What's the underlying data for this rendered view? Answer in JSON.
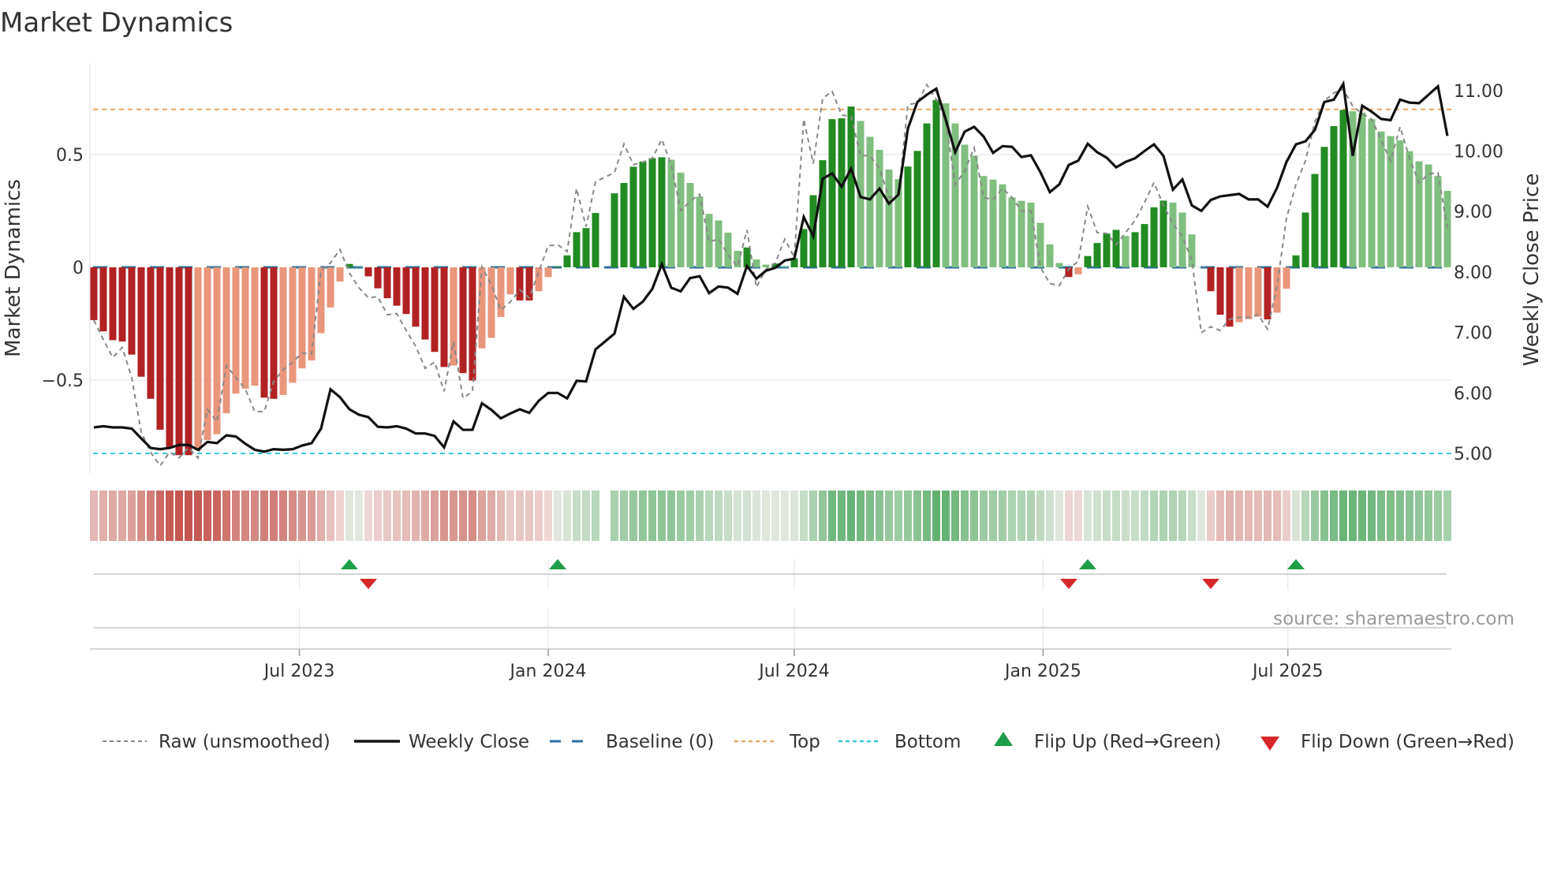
{
  "title": "Market Dynamics",
  "source": "source: sharemaestro.com",
  "colors": {
    "strong_red": "#b22222",
    "weak_red": "#e9967a",
    "strong_green": "#228b22",
    "weak_green": "#7fbf7f",
    "raw": "#888888",
    "close": "#111111",
    "baseline": "#2b6f9e",
    "top": "#e8a862",
    "bottom": "#3cc8d8",
    "flip_up": "#1e9e4a",
    "flip_down": "#d62728",
    "heat_red": "#c4544c",
    "heat_green": "#4fab62"
  },
  "legend": [
    {
      "key": "raw",
      "label": "Raw (unsmoothed)"
    },
    {
      "key": "close",
      "label": "Weekly Close"
    },
    {
      "key": "baseline",
      "label": "Baseline (0)"
    },
    {
      "key": "top",
      "label": "Top"
    },
    {
      "key": "bottom",
      "label": "Bottom"
    },
    {
      "key": "flip_up",
      "label": "Flip Up (Red→Green)"
    },
    {
      "key": "flip_down",
      "label": "Flip Down (Green→Red)"
    }
  ],
  "chart_data": {
    "type": "bar",
    "title": "Market Dynamics",
    "ylabel": "Market Dynamics",
    "y2label": "Weekly Close Price",
    "x_start": "2023-01-30",
    "x_step_days": 7,
    "x_ticks": [
      {
        "date": "2023-07-01",
        "label": "Jul 2023"
      },
      {
        "date": "2024-01-01",
        "label": "Jan 2024"
      },
      {
        "date": "2024-07-01",
        "label": "Jul 2024"
      },
      {
        "date": "2025-01-01",
        "label": "Jan 2025"
      },
      {
        "date": "2025-07-01",
        "label": "Jul 2025"
      }
    ],
    "y_ticks": [
      {
        "v": 0.5,
        "label": "0.5"
      },
      {
        "v": 0,
        "label": "0"
      },
      {
        "v": -0.5,
        "label": "−0.5"
      }
    ],
    "y2_ticks": [
      {
        "v": 11,
        "label": "11.00"
      },
      {
        "v": 10,
        "label": "10.00"
      },
      {
        "v": 9,
        "label": "9.00"
      },
      {
        "v": 8,
        "label": "8.00"
      },
      {
        "v": 7,
        "label": "7.00"
      },
      {
        "v": 6,
        "label": "6.00"
      },
      {
        "v": 5,
        "label": "5.00"
      }
    ],
    "ylim": [
      -0.91,
      0.91
    ],
    "y2lim": [
      4.5,
      11.55
    ],
    "top": 0.7,
    "bottom": -0.825,
    "baseline": 0,
    "grid": true,
    "legend_position": "bottom",
    "values": [
      -0.234,
      -0.284,
      -0.323,
      -0.329,
      -0.387,
      -0.485,
      -0.583,
      -0.72,
      -0.8,
      -0.833,
      -0.833,
      -0.81,
      -0.766,
      -0.74,
      -0.647,
      -0.56,
      -0.538,
      -0.525,
      -0.578,
      -0.583,
      -0.566,
      -0.512,
      -0.448,
      -0.413,
      -0.292,
      -0.178,
      -0.063,
      0.015,
      0.002,
      -0.04,
      -0.093,
      -0.137,
      -0.17,
      -0.207,
      -0.263,
      -0.32,
      -0.375,
      -0.442,
      -0.436,
      -0.469,
      -0.502,
      -0.359,
      -0.313,
      -0.22,
      -0.12,
      -0.147,
      -0.147,
      -0.106,
      -0.043,
      0.004,
      0.053,
      0.156,
      0.174,
      0.241,
      null,
      0.328,
      0.374,
      0.446,
      0.469,
      0.484,
      0.488,
      0.477,
      0.42,
      0.374,
      0.314,
      0.237,
      0.208,
      0.154,
      0.073,
      0.088,
      0.035,
      0.012,
      0.017,
      0.004,
      0.04,
      0.17,
      0.32,
      0.475,
      0.657,
      0.661,
      0.713,
      0.649,
      0.579,
      0.521,
      0.434,
      0.391,
      0.447,
      0.516,
      0.638,
      0.742,
      0.727,
      0.638,
      0.544,
      0.495,
      0.405,
      0.389,
      0.368,
      0.31,
      0.295,
      0.287,
      0.197,
      0.102,
      0.019,
      -0.043,
      -0.031,
      0.05,
      0.108,
      0.15,
      0.166,
      0.139,
      0.156,
      0.192,
      0.266,
      0.296,
      0.287,
      0.243,
      0.146,
      0.002,
      -0.106,
      -0.21,
      -0.263,
      -0.243,
      -0.23,
      -0.219,
      -0.231,
      -0.201,
      -0.095,
      0.053,
      0.243,
      0.414,
      0.534,
      0.626,
      0.698,
      0.692,
      0.686,
      0.657,
      0.602,
      0.582,
      0.5625,
      0.515,
      0.47,
      0.456,
      0.405,
      0.339
    ],
    "raw": [
      -0.234,
      -0.32,
      -0.4,
      -0.355,
      -0.49,
      -0.73,
      -0.82,
      -0.88,
      -0.82,
      -0.845,
      -0.8,
      -0.845,
      -0.63,
      -0.685,
      -0.436,
      -0.488,
      -0.54,
      -0.64,
      -0.64,
      -0.506,
      -0.454,
      -0.42,
      -0.38,
      -0.384,
      -0.014,
      0.02,
      0.079,
      -0.025,
      -0.09,
      -0.135,
      -0.13,
      -0.21,
      -0.205,
      -0.28,
      -0.35,
      -0.448,
      -0.42,
      -0.55,
      -0.33,
      -0.58,
      -0.55,
      0.003,
      -0.078,
      -0.19,
      -0.153,
      -0.1,
      -0.135,
      -0.02,
      0.096,
      0.1,
      0.07,
      0.35,
      0.18,
      0.38,
      0.4,
      0.42,
      0.547,
      0.455,
      0.466,
      0.484,
      0.567,
      0.455,
      0.252,
      0.293,
      0.324,
      0.113,
      0.125,
      0.056,
      0.003,
      0.166,
      -0.089,
      -0.008,
      0.02,
      0.125,
      0.044,
      0.657,
      0.46,
      0.75,
      0.78,
      0.675,
      0.669,
      0.495,
      0.495,
      0.4375,
      0.31,
      0.32,
      0.72,
      0.73,
      0.81,
      0.744,
      0.646,
      0.368,
      0.426,
      0.53,
      0.31,
      0.3,
      0.35,
      0.31,
      0.25,
      0.25,
      0.0,
      -0.072,
      -0.081,
      -0.008,
      0.027,
      0.27,
      0.154,
      0.15,
      0.1,
      0.154,
      0.208,
      0.287,
      0.376,
      0.275,
      0.194,
      0.137,
      0.032,
      -0.29,
      -0.263,
      -0.28,
      -0.23,
      -0.222,
      -0.222,
      -0.21,
      -0.274,
      -0.083,
      0.218,
      0.368,
      0.472,
      0.646,
      0.738,
      0.773,
      0.79,
      0.715,
      0.68,
      0.657,
      0.565,
      0.472,
      0.623,
      0.484,
      0.374,
      0.414,
      0.42,
      0.171
    ],
    "close": [
      5.43,
      5.45,
      5.43,
      5.43,
      5.41,
      5.25,
      5.09,
      5.07,
      5.09,
      5.14,
      5.14,
      5.06,
      5.19,
      5.17,
      5.3,
      5.28,
      5.16,
      5.06,
      5.03,
      5.07,
      5.06,
      5.07,
      5.13,
      5.17,
      5.41,
      6.06,
      5.93,
      5.73,
      5.64,
      5.6,
      5.44,
      5.43,
      5.45,
      5.41,
      5.33,
      5.33,
      5.29,
      5.1,
      5.53,
      5.39,
      5.39,
      5.83,
      5.72,
      5.58,
      5.66,
      5.73,
      5.67,
      5.87,
      6.0,
      6.0,
      5.91,
      6.2,
      6.19,
      6.72,
      6.85,
      6.98,
      7.59,
      7.39,
      7.51,
      7.72,
      8.13,
      7.74,
      7.68,
      7.9,
      7.93,
      7.65,
      7.76,
      7.74,
      7.64,
      8.1,
      7.89,
      8.02,
      8.07,
      8.19,
      8.22,
      8.91,
      8.59,
      9.54,
      9.63,
      9.41,
      9.71,
      9.24,
      9.2,
      9.38,
      9.13,
      9.28,
      10.37,
      10.81,
      10.93,
      11.03,
      10.52,
      9.98,
      10.32,
      10.4,
      10.24,
      9.97,
      10.08,
      10.07,
      9.9,
      9.93,
      9.65,
      9.32,
      9.45,
      9.77,
      9.84,
      10.12,
      9.98,
      9.89,
      9.73,
      9.82,
      9.88,
      10.0,
      10.11,
      9.92,
      9.36,
      9.53,
      9.1,
      9.01,
      9.19,
      9.25,
      9.27,
      9.29,
      9.2,
      9.2,
      9.08,
      9.39,
      9.82,
      10.11,
      10.16,
      10.35,
      10.81,
      10.85,
      11.11,
      9.92,
      10.75,
      10.65,
      10.53,
      10.51,
      10.85,
      10.8,
      10.79,
      10.93,
      11.07,
      10.25
    ],
    "flip_up_weeks": [
      27,
      49,
      105,
      127
    ],
    "flip_down_weeks": [
      29,
      103,
      118
    ]
  }
}
